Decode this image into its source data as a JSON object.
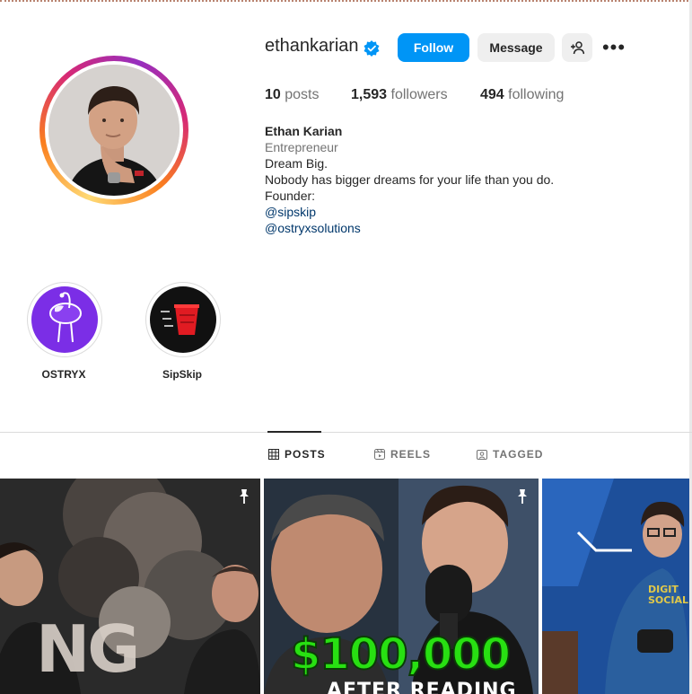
{
  "profile": {
    "username": "ethankarian",
    "actions": {
      "follow": "Follow",
      "message": "Message"
    },
    "stats": {
      "posts_count": "10",
      "posts_label": "posts",
      "followers_count": "1,593",
      "followers_label": "followers",
      "following_count": "494",
      "following_label": "following"
    },
    "bio": {
      "name": "Ethan Karian",
      "category": "Entrepreneur",
      "lines": [
        "Dream Big.",
        "Nobody has bigger dreams for your life than you do.",
        "Founder:"
      ],
      "mentions": [
        "@sipskip",
        "@ostryxsolutions"
      ]
    }
  },
  "highlights": [
    {
      "label": "OSTRYX",
      "icon": "ostrich-icon",
      "bg": "#7b2ee6"
    },
    {
      "label": "SipSkip",
      "icon": "red-cup-icon",
      "bg": "#111111"
    }
  ],
  "tabs": [
    {
      "label": "POSTS",
      "icon": "grid-icon",
      "active": true
    },
    {
      "label": "REELS",
      "icon": "reels-icon",
      "active": false
    },
    {
      "label": "TAGGED",
      "icon": "tagged-icon",
      "active": false
    }
  ],
  "posts": [
    {
      "overlay_text": "NG",
      "pinned": true
    },
    {
      "overlay_text": "$100,000",
      "overlay_subtext": "AFTER READING",
      "pinned": true
    },
    {
      "overlay_text": "DIGIT SOCIAL",
      "pinned": false
    }
  ],
  "colors": {
    "accent": "#0095f6",
    "verified": "#0095f6",
    "link": "#00376b",
    "muted": "#737373",
    "money_green": "#28e012"
  }
}
